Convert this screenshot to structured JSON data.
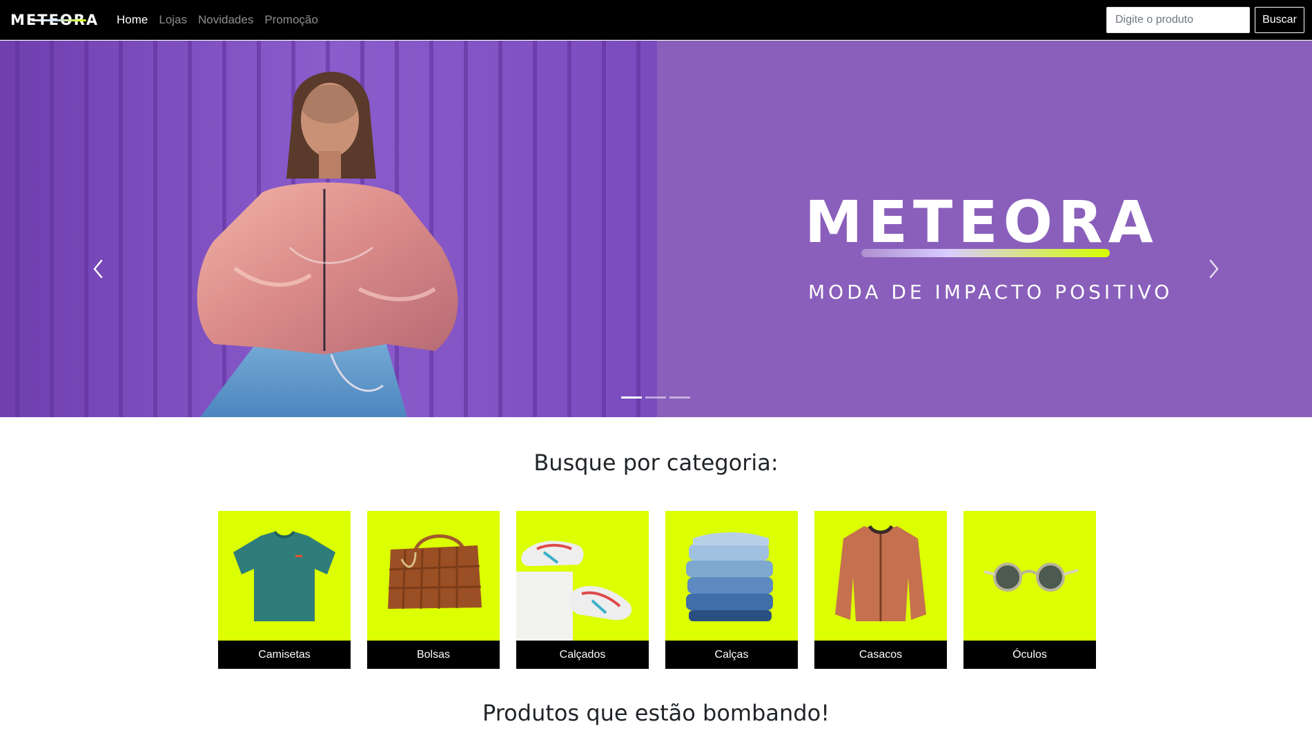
{
  "nav": {
    "brand": "METEORA",
    "links": [
      {
        "label": "Home",
        "active": true
      },
      {
        "label": "Lojas",
        "active": false
      },
      {
        "label": "Novidades",
        "active": false
      },
      {
        "label": "Promoção",
        "active": false
      }
    ],
    "search": {
      "placeholder": "Digite o produto",
      "value": ""
    },
    "search_button": "Buscar"
  },
  "carousel": {
    "hero_title": "METEORA",
    "hero_subtitle": "MODA DE IMPACTO POSITIVO",
    "slides_count": 3,
    "active_slide": 0,
    "prev_icon": "chevron-left-icon",
    "next_icon": "chevron-right-icon"
  },
  "categories": {
    "title": "Busque por categoria:",
    "items": [
      {
        "label": "Camisetas",
        "icon": "tshirt"
      },
      {
        "label": "Bolsas",
        "icon": "bag"
      },
      {
        "label": "Calçados",
        "icon": "sneakers"
      },
      {
        "label": "Calças",
        "icon": "jeans"
      },
      {
        "label": "Casacos",
        "icon": "jacket"
      },
      {
        "label": "Óculos",
        "icon": "sunglasses"
      }
    ]
  },
  "trending": {
    "title": "Produtos que estão bombando!"
  },
  "colors": {
    "navbar_bg": "#000000",
    "hero_bg": "#8a5fbb",
    "category_bg": "#dcff01",
    "accent_lime": "#d7ff00"
  }
}
